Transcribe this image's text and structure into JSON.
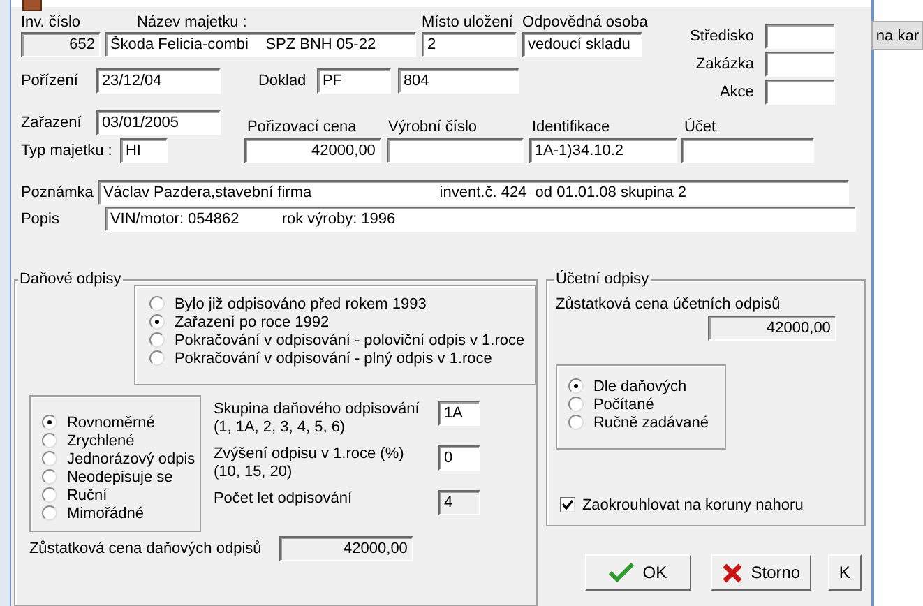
{
  "top_fields": {
    "inv_number": {
      "label": "Inv. číslo",
      "value": "652",
      "readonly": true
    },
    "asset_name": {
      "label": "Název majetku :",
      "value": "Škoda Felicia-combi    SPZ BNH 05-22"
    },
    "location": {
      "label": "Místo uložení",
      "value": "2"
    },
    "responsible": {
      "label": "Odpovědná osoba",
      "value": "vedoucí skladu"
    }
  },
  "side_fields": [
    {
      "label": "Středisko"
    },
    {
      "label": "Zakázka"
    },
    {
      "label": "Akce"
    }
  ],
  "acquired": {
    "label": "Pořízení",
    "value": "23/12/04"
  },
  "placed": {
    "label": "Zařazení",
    "value": "03/01/2005"
  },
  "document": {
    "label": "Doklad",
    "value": "PF",
    "number": "804"
  },
  "asset_type": {
    "label": "Typ majetku :",
    "value": "HI"
  },
  "price": {
    "label": "Pořizovací cena",
    "value": "42000,00"
  },
  "serial": {
    "label": "Výrobní číslo"
  },
  "identification": {
    "label": "Identifikace",
    "value": "1A-1)34.10.2"
  },
  "account": {
    "label": "Účet"
  },
  "note": {
    "label": "Poznámka",
    "value": "Václav Pazdera,stavební firma                              invent.č. 424  od 01.01.08 skupina 2"
  },
  "description": {
    "label": "Popis",
    "value": "VIN/motor: 054862          rok výroby: 1996"
  },
  "tax_depreciation": {
    "title": "Daňové odpisy",
    "periods": [
      {
        "label": "Bylo již odpisováno před rokem 1993",
        "selected": false
      },
      {
        "label": "Zařazení po roce 1992",
        "selected": true
      },
      {
        "label": "Pokračování v odpisování - poloviční odpis v 1.roce",
        "selected": false
      },
      {
        "label": "Pokračování v odpisování - plný odpis v 1.roce",
        "selected": false
      }
    ],
    "methods": [
      {
        "label": "Rovnoměrné",
        "selected": true
      },
      {
        "label": "Zrychlené",
        "selected": false
      },
      {
        "label": "Jednorázový odpis",
        "selected": false
      },
      {
        "label": "Neodepisuje se",
        "selected": false
      },
      {
        "label": "Ruční",
        "selected": false
      },
      {
        "label": "Mimořádné",
        "selected": false
      }
    ],
    "params": [
      {
        "label": "Skupina daňového odpisování",
        "hint": "(1, 1A, 2, 3, 4, 5, 6)",
        "value": "1A",
        "readonly": false
      },
      {
        "label": "Zvýšení odpisu v 1.roce (%)",
        "hint": "(10, 15, 20)",
        "value": "0",
        "readonly": false
      },
      {
        "label": "Počet let odpisování",
        "value": "4",
        "readonly": true
      }
    ],
    "residual": {
      "label": "Zůstatková cena daňových odpisů",
      "value": "42000,00",
      "readonly": true
    }
  },
  "accounting_depreciation": {
    "title": "Účetní odpisy",
    "residual": {
      "label": "Zůstatková cena účetních odpisů",
      "value": "42000,00",
      "readonly": true
    },
    "modes": [
      {
        "label": "Dle daňových",
        "selected": true
      },
      {
        "label": "Počítané",
        "selected": false
      },
      {
        "label": "Ručně zadávané",
        "selected": false
      }
    ],
    "round_up": {
      "label": "Zaokrouhlovat na koruny nahoru",
      "checked": true
    }
  },
  "buttons": [
    {
      "label": "OK",
      "kind": "ok"
    },
    {
      "label": "Storno",
      "kind": "cancel"
    },
    {
      "label": "K",
      "kind": "plain"
    }
  ],
  "background_window": {
    "button": "na kar"
  }
}
